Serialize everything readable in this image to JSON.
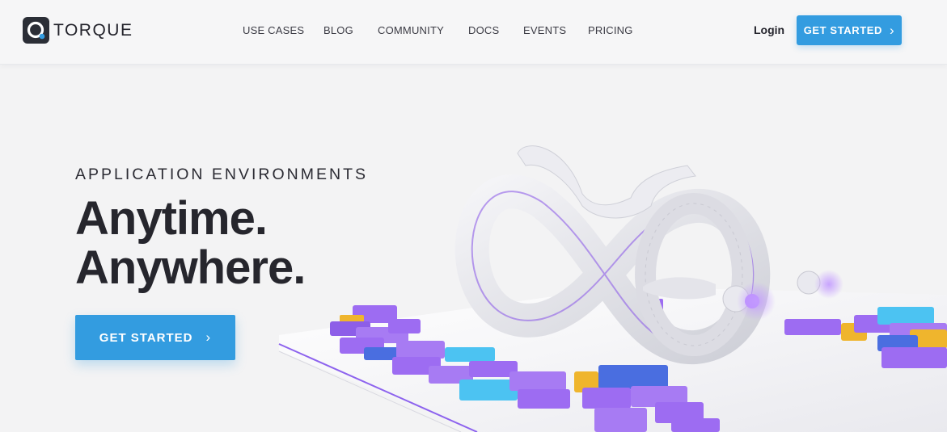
{
  "brand": {
    "name": "TORQUE"
  },
  "nav": {
    "items": [
      "USE CASES",
      "BLOG",
      "COMMUNITY",
      "DOCS",
      "EVENTS",
      "PRICING"
    ],
    "login": "Login",
    "cta": "GET STARTED",
    "cta_chevron": "›"
  },
  "hero": {
    "eyebrow": "APPLICATION ENVIRONMENTS",
    "headline_line1": "Anytime.",
    "headline_line2": "Anywhere.",
    "cta": "GET STARTED",
    "cta_chevron": "›"
  },
  "colors": {
    "accent": "#339ce0",
    "text_dark": "#26262d",
    "background": "#f3f3f4",
    "block_purple": "#9d6cf2",
    "block_blue": "#4a6ee0",
    "block_cyan": "#4cc3f2",
    "block_yellow": "#efb52d"
  },
  "icons": [
    "torque-logo-icon",
    "chevron-right-icon"
  ]
}
